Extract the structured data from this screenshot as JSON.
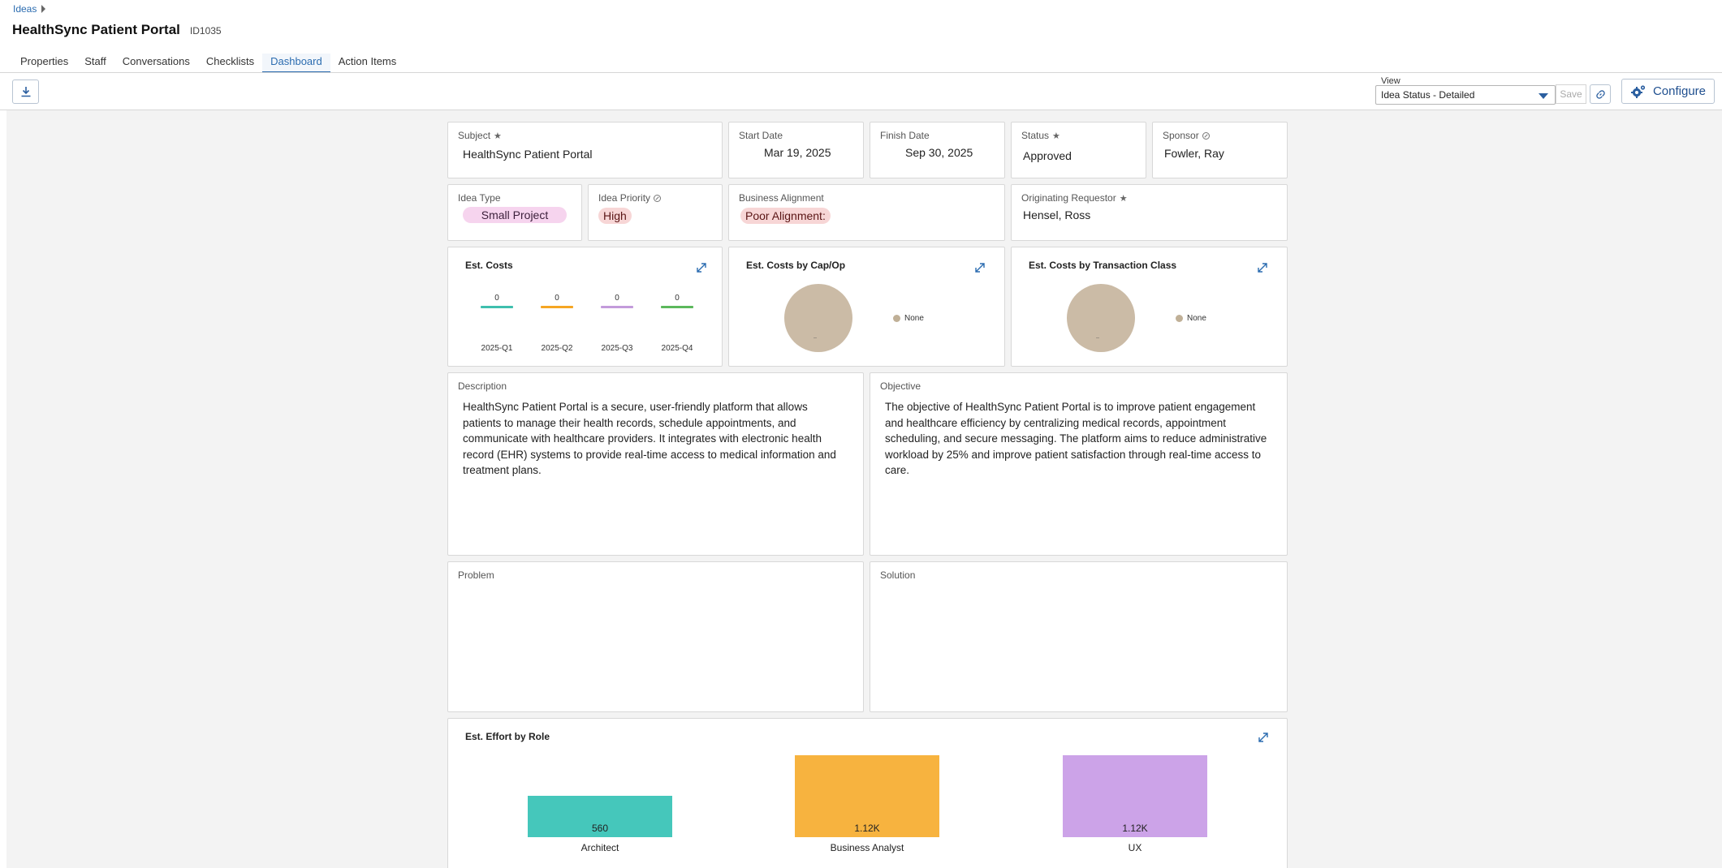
{
  "breadcrumb": {
    "root": "Ideas"
  },
  "header": {
    "title": "HealthSync Patient Portal",
    "id": "ID1035"
  },
  "tabs": [
    {
      "label": "Properties"
    },
    {
      "label": "Staff"
    },
    {
      "label": "Conversations"
    },
    {
      "label": "Checklists"
    },
    {
      "label": "Dashboard",
      "active": true
    },
    {
      "label": "Action Items"
    }
  ],
  "toolbar": {
    "view_label": "View",
    "view_value": "Idea Status - Detailed",
    "save_label": "Save",
    "configure_label": "Configure"
  },
  "fields": {
    "subject": {
      "label": "Subject",
      "value": "HealthSync Patient Portal"
    },
    "start_date": {
      "label": "Start Date",
      "value": "Mar 19, 2025"
    },
    "finish_date": {
      "label": "Finish Date",
      "value": "Sep 30, 2025"
    },
    "status": {
      "label": "Status",
      "value": "Approved"
    },
    "sponsor": {
      "label": "Sponsor",
      "value": "Fowler, Ray"
    },
    "idea_type": {
      "label": "Idea Type",
      "value": "Small Project",
      "color": "#f6d4ee"
    },
    "idea_priority": {
      "label": "Idea Priority",
      "value": "High",
      "color": "#f7d6d6"
    },
    "business_alignment": {
      "label": "Business Alignment",
      "value": "Poor Alignment:",
      "color": "#f7d6d6"
    },
    "originating_requestor": {
      "label": "Originating Requestor",
      "value": "Hensel, Ross"
    }
  },
  "est_costs": {
    "title": "Est. Costs",
    "chart_data": {
      "type": "bar",
      "categories": [
        "2025-Q1",
        "2025-Q2",
        "2025-Q3",
        "2025-Q4"
      ],
      "values": [
        0,
        0,
        0,
        0
      ],
      "colors": [
        "#3fbfae",
        "#f5a623",
        "#c39bdb",
        "#5cb85c"
      ]
    }
  },
  "cap_op": {
    "title": "Est. Costs by Cap/Op",
    "chart_data": {
      "type": "pie",
      "labels": [
        "None"
      ],
      "values": [
        1
      ],
      "colors": [
        "#cbbba6"
      ]
    },
    "legend": "None",
    "slice_label": "--"
  },
  "transaction": {
    "title": "Est. Costs by Transaction Class",
    "chart_data": {
      "type": "pie",
      "labels": [
        "None"
      ],
      "values": [
        1
      ],
      "colors": [
        "#cbbba6"
      ]
    },
    "legend": "None",
    "slice_label": "--"
  },
  "description": {
    "label": "Description",
    "text": "HealthSync Patient Portal is a secure, user-friendly platform that allows patients to manage their health records, schedule appointments, and communicate with healthcare providers. It integrates with electronic health record (EHR) systems to provide real-time access to medical information and treatment plans."
  },
  "objective": {
    "label": "Objective",
    "text": "The objective of HealthSync Patient Portal is to improve patient engagement and healthcare efficiency by centralizing medical records, appointment scheduling, and secure messaging. The platform aims to reduce administrative workload by 25% and improve patient satisfaction through real-time access to care."
  },
  "problem": {
    "label": "Problem",
    "text": ""
  },
  "solution": {
    "label": "Solution",
    "text": ""
  },
  "effort": {
    "title": "Est. Effort by Role",
    "chart_data": {
      "type": "bar",
      "categories": [
        "Architect",
        "Business Analyst",
        "UX"
      ],
      "values": [
        560,
        1120,
        1120
      ],
      "value_labels": [
        "560",
        "1.12K",
        "1.12K"
      ],
      "colors": [
        "#45c7bb",
        "#f7b33f",
        "#cca3e8"
      ]
    }
  }
}
